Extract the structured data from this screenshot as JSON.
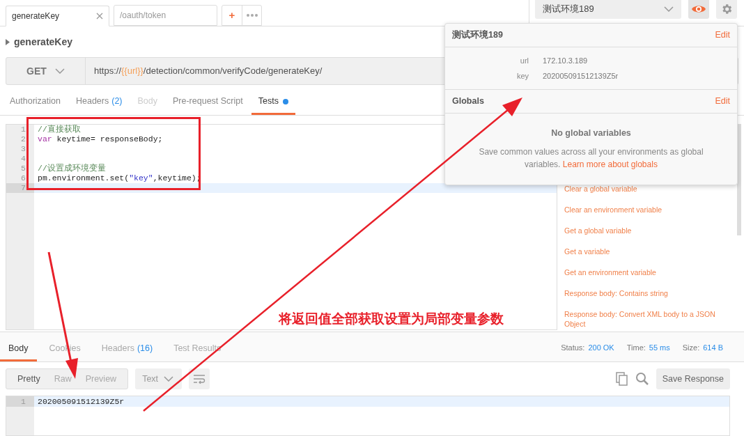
{
  "request_tabs": [
    {
      "label": "generateKey",
      "selected": true,
      "closable": true
    },
    {
      "label": "/oauth/token",
      "selected": false,
      "closable": false
    }
  ],
  "new_tab_button": "+",
  "environment": {
    "selected": "测试环境189"
  },
  "request_name": "generateKey",
  "method": "GET",
  "url": {
    "prefix": "https://",
    "variable": "{{url}}",
    "path": "/detection/common/verifyCode/generateKey/"
  },
  "request_section_tabs": [
    {
      "label": "Authorization",
      "selected": false,
      "disabled": false,
      "modified": false
    },
    {
      "label": "Headers",
      "count": "(2)",
      "selected": false,
      "disabled": false,
      "modified": false
    },
    {
      "label": "Body",
      "selected": false,
      "disabled": true,
      "modified": false
    },
    {
      "label": "Pre-request Script",
      "selected": false,
      "disabled": false,
      "modified": false
    },
    {
      "label": "Tests",
      "selected": true,
      "disabled": false,
      "modified": true
    }
  ],
  "editor": {
    "lines": [
      {
        "number": "1",
        "current": false,
        "tokens": [
          {
            "kind": "comment",
            "text": "//直接获取"
          }
        ]
      },
      {
        "number": "2",
        "current": false,
        "tokens": [
          {
            "kind": "keyword",
            "text": "var"
          },
          {
            "kind": "plain",
            "text": " keytime= responseBody;"
          }
        ]
      },
      {
        "number": "3",
        "current": false
      },
      {
        "number": "4",
        "current": false
      },
      {
        "number": "5",
        "current": false,
        "tokens": [
          {
            "kind": "comment",
            "text": "//设置成环境变量"
          }
        ]
      },
      {
        "number": "6",
        "current": false,
        "tokens": [
          {
            "kind": "plain",
            "text": "pm.environment.set("
          },
          {
            "kind": "string",
            "text": "\"key\""
          },
          {
            "kind": "plain",
            "text": ",keytime);"
          }
        ]
      },
      {
        "number": "7",
        "current": true
      }
    ]
  },
  "snippets": [
    "Clear a global variable",
    "Clear an environment variable",
    "Get a global variable",
    "Get a variable",
    "Get an environment variable",
    "Response body: Contains string",
    "Response body: Convert XML body to a JSON Object"
  ],
  "environment_popup": {
    "title": "测试环境189",
    "edit": "Edit",
    "variables": [
      {
        "name": "url",
        "value": "172.10.3.189"
      },
      {
        "name": "key",
        "value": "202005091512139Z5r"
      }
    ],
    "globals_title": "Globals",
    "globals_edit": "Edit",
    "empty_title": "No global variables",
    "empty_text": "Save common values across all your environments as global variables.",
    "empty_link": "Learn more about globals"
  },
  "annotation": {
    "text": "将返回值全部获取设置为局部变量参数"
  },
  "response_tabs": [
    {
      "label": "Body",
      "selected": true
    },
    {
      "label": "Cookies",
      "selected": false
    },
    {
      "label": "Headers",
      "count": "(16)",
      "selected": false
    },
    {
      "label": "Test Results",
      "selected": false
    }
  ],
  "status": [
    {
      "label": "Status:",
      "value": "200 OK"
    },
    {
      "label": "Time:",
      "value": "55 ms"
    },
    {
      "label": "Size:",
      "value": "614 B"
    }
  ],
  "view_modes": [
    {
      "label": "Pretty",
      "selected": true
    },
    {
      "label": "Raw",
      "selected": false
    },
    {
      "label": "Preview",
      "selected": false
    }
  ],
  "format": "Text",
  "save_button": "Save Response",
  "response_lines": [
    {
      "number": "1",
      "text": "202005091512139Z5r",
      "current": true
    }
  ]
}
